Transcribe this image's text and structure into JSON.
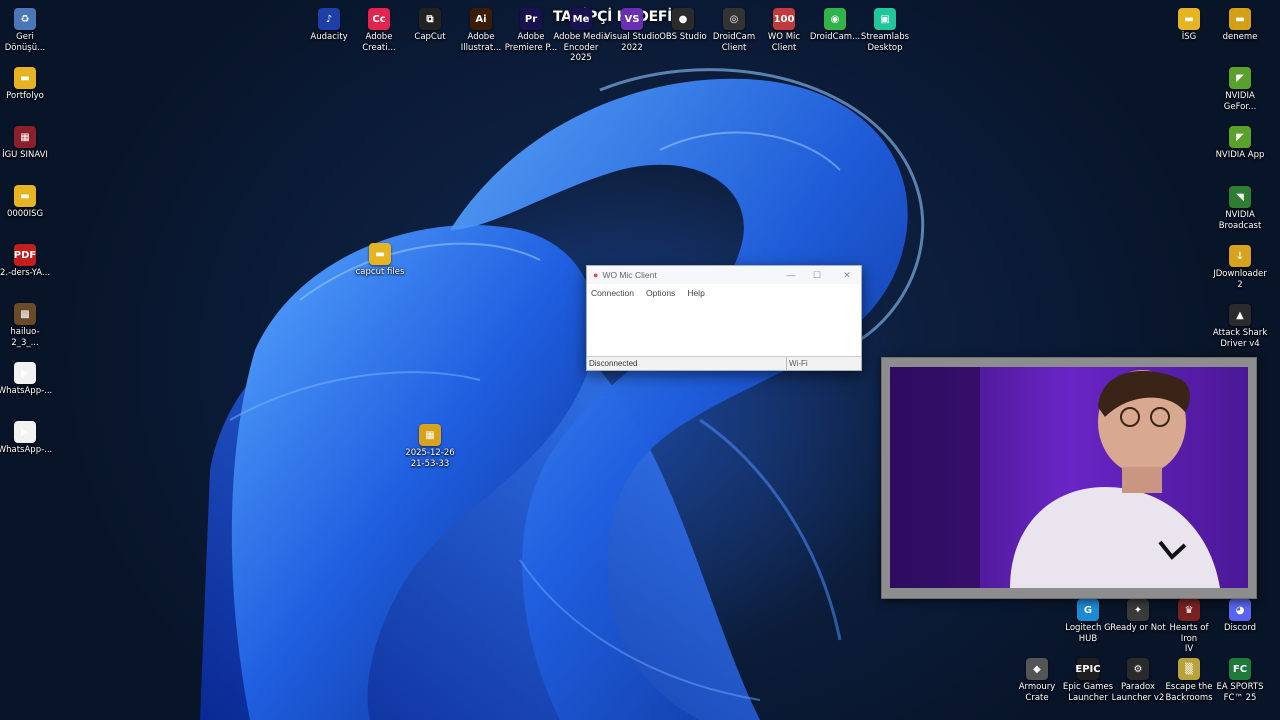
{
  "desktop": {
    "banner": "TAKİPÇİ HEDEFİ",
    "top_icons": [
      {
        "label": "Audacity",
        "glyph": "♪",
        "color": "#1f3fa8"
      },
      {
        "label": "Adobe\nCreati...",
        "glyph": "Cc",
        "color": "#e2244f"
      },
      {
        "label": "CapCut",
        "glyph": "⧉",
        "color": "#222"
      },
      {
        "label": "Adobe\nIllustrat...",
        "glyph": "Ai",
        "color": "#3b1c05"
      },
      {
        "label": "Adobe\nPremiere P...",
        "glyph": "Pr",
        "color": "#1a1150"
      },
      {
        "label": "Adobe Media\nEncoder 2025",
        "glyph": "Me",
        "color": "#1a1150"
      },
      {
        "label": "Visual Studio\n2022",
        "glyph": "VS",
        "color": "#6a2fb0"
      },
      {
        "label": "OBS Studio",
        "glyph": "●",
        "color": "#2b2b2b"
      },
      {
        "label": "DroidCam\nClient",
        "glyph": "◎",
        "color": "#333"
      },
      {
        "label": "WO Mic\nClient",
        "glyph": "100",
        "color": "#c23a3a"
      },
      {
        "label": "DroidCam...",
        "glyph": "◉",
        "color": "#2fb34a"
      },
      {
        "label": "Streamlabs\nDesktop",
        "glyph": "▣",
        "color": "#21c79a"
      }
    ],
    "left_icons": [
      {
        "label": "Geri\nDönüşü...",
        "glyph": "♻",
        "color": "#4a77b8"
      },
      {
        "label": "Portfolyo",
        "glyph": "▬",
        "color": "#e6b422"
      },
      {
        "label": "İGU SINAVI",
        "glyph": "▦",
        "color": "#8b1f2a"
      },
      {
        "label": "0000ISG",
        "glyph": "▬",
        "color": "#e6b422"
      },
      {
        "label": "2.-ders-YA...",
        "glyph": "PDF",
        "color": "#c41f1f"
      },
      {
        "label": "hailuo-2_3_...",
        "glyph": "▩",
        "color": "#6b4a2a"
      },
      {
        "label": "WhatsApp-...",
        "glyph": "▶",
        "color": "#f2f2f2"
      },
      {
        "label": "WhatsApp-...",
        "glyph": "▶",
        "color": "#f2f2f2"
      }
    ],
    "right_icons": [
      {
        "label": "İSG",
        "glyph": "▬",
        "color": "#e6b422"
      },
      {
        "label": "deneme",
        "glyph": "▬",
        "color": "#d4a017"
      },
      {
        "label": "NVIDIA\nGeFor...",
        "glyph": "◤",
        "color": "#5aa02c"
      },
      {
        "label": "NVIDIA App",
        "glyph": "◤",
        "color": "#5aa02c"
      },
      {
        "label": "NVIDIA\nBroadcast",
        "glyph": "◥",
        "color": "#2e7d32"
      },
      {
        "label": "JDownloader\n2",
        "glyph": "↓",
        "color": "#d7a21e"
      },
      {
        "label": "Attack Shark\nDriver v4",
        "glyph": "▲",
        "color": "#2b2b2b"
      }
    ],
    "bottom_right_icons": [
      {
        "label": "Logitech G\nHUB",
        "glyph": "G",
        "color": "#1d8ad6"
      },
      {
        "label": "Ready or Not",
        "glyph": "✦",
        "color": "#3a3a3a"
      },
      {
        "label": "Hearts of Iron\nIV",
        "glyph": "♛",
        "color": "#7a2222"
      },
      {
        "label": "Discord",
        "glyph": "◕",
        "color": "#5865f2"
      },
      {
        "label": "Armoury\nCrate",
        "glyph": "◆",
        "color": "#555"
      },
      {
        "label": "Epic Games\nLauncher",
        "glyph": "EPIC",
        "color": "#1f1f1f"
      },
      {
        "label": "Paradox\nLauncher v2",
        "glyph": "⚙",
        "color": "#2a2a2a"
      },
      {
        "label": "Escape the\nBackrooms",
        "glyph": "▒",
        "color": "#b9a23a"
      },
      {
        "label": "EA SPORTS\nFC™ 25",
        "glyph": "FC",
        "color": "#1d7a3a"
      }
    ],
    "mid_icons": [
      {
        "label": "capcut files",
        "glyph": "▬",
        "color": "#e6b422"
      },
      {
        "label": "2025-12-26\n21-53-33",
        "glyph": "▦",
        "color": "#d8a21f"
      }
    ]
  },
  "wo_mic": {
    "title": "WO Mic Client",
    "menu": [
      "Connection",
      "Options",
      "Help"
    ],
    "status_left": "Disconnected",
    "status_right": "Wi-Fi",
    "controls": {
      "minimize": "—",
      "maximize": "☐",
      "close": "✕"
    }
  }
}
